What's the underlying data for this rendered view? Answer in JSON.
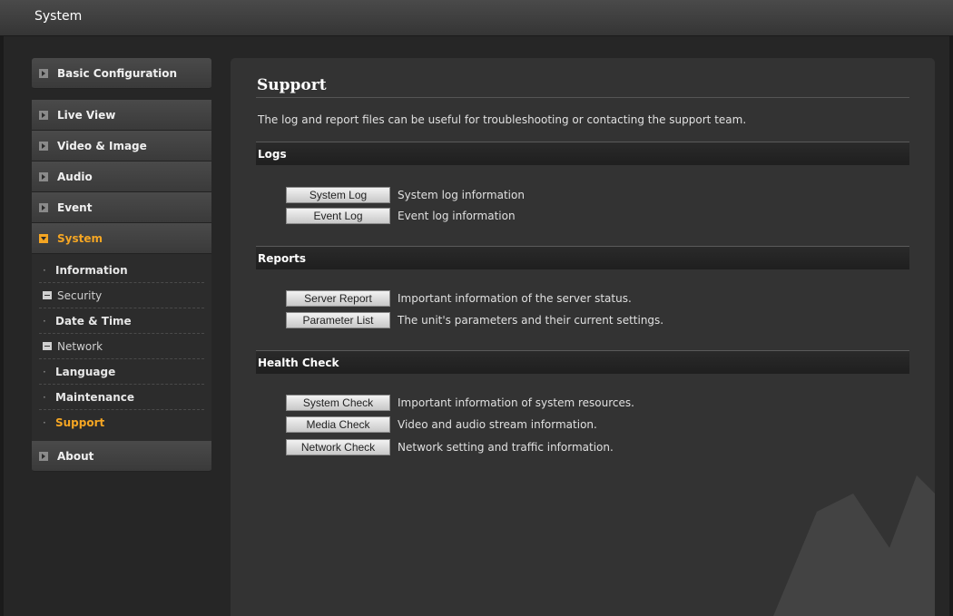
{
  "topbar": {
    "title": "System"
  },
  "sidebar": {
    "top_item": {
      "label": "Basic Configuration"
    },
    "items": [
      {
        "label": "Live View"
      },
      {
        "label": "Video & Image"
      },
      {
        "label": "Audio"
      },
      {
        "label": "Event"
      },
      {
        "label": "System"
      }
    ],
    "subitems": [
      {
        "label": "Information"
      },
      {
        "label": "Security"
      },
      {
        "label": "Date & Time"
      },
      {
        "label": "Network"
      },
      {
        "label": "Language"
      },
      {
        "label": "Maintenance"
      },
      {
        "label": "Support"
      }
    ],
    "bottom_item": {
      "label": "About"
    }
  },
  "main": {
    "title": "Support",
    "intro": "The log and report files can be useful for troubleshooting or contacting the support team.",
    "sections": [
      {
        "header": "Logs",
        "rows": [
          {
            "button": "System Log",
            "desc": "System log information"
          },
          {
            "button": "Event Log",
            "desc": "Event log information"
          }
        ]
      },
      {
        "header": "Reports",
        "rows": [
          {
            "button": "Server Report",
            "desc": "Important information of the server status."
          },
          {
            "button": "Parameter List",
            "desc": "The unit's parameters and their current settings."
          }
        ]
      },
      {
        "header": "Health Check",
        "rows": [
          {
            "button": "System Check",
            "desc": "Important information of system resources."
          },
          {
            "button": "Media Check",
            "desc": "Video and audio stream information."
          },
          {
            "button": "Network Check",
            "desc": "Network setting and traffic information."
          }
        ]
      }
    ]
  },
  "colors": {
    "accent": "#f5a623",
    "background": "#262626",
    "panel": "#333333"
  }
}
